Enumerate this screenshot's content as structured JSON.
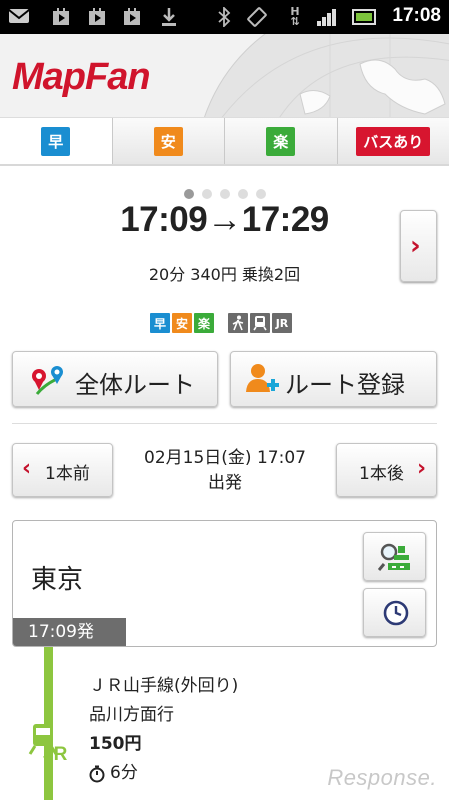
{
  "status_bar": {
    "time": "17:08",
    "icons": [
      "mail-icon",
      "play-store-icon",
      "play-store-icon",
      "play-store-icon",
      "download-icon",
      "bluetooth-icon",
      "screen-rotation-icon",
      "hsdpa-icon",
      "signal-icon",
      "battery-icon"
    ]
  },
  "header": {
    "logo": "MapFan"
  },
  "tabs": [
    {
      "label": "早",
      "color": "#1a8ed1",
      "active": true
    },
    {
      "label": "安",
      "color": "#f08a1c",
      "active": false
    },
    {
      "label": "楽",
      "color": "#3bab3a",
      "active": false
    },
    {
      "label": "バスあり",
      "color": "#d7152f",
      "active": false
    }
  ],
  "route": {
    "time_range": "17:09→17:29",
    "summary": "20分 340円 乗換2回",
    "badges": [
      {
        "label": "早",
        "color": "#1a8ed1"
      },
      {
        "label": "安",
        "color": "#f08a1c"
      },
      {
        "label": "楽",
        "color": "#3bab3a"
      }
    ],
    "modes": [
      {
        "icon": "walk-icon",
        "label": ""
      },
      {
        "icon": "train-icon",
        "label": ""
      },
      {
        "icon": "jr-icon",
        "label": "JR"
      }
    ]
  },
  "actions": {
    "full_route": "全体ルート",
    "register_route": "ルート登録"
  },
  "departure": {
    "prev": "1本前",
    "next": "1本後",
    "date_time": "02月15日(金) 17:07",
    "mode": "出発"
  },
  "station": {
    "name": "東京",
    "depart_tag": "17:09発"
  },
  "segment": {
    "line": "ＪＲ山手線(外回り)",
    "direction": "品川方面行",
    "fare": "150円",
    "duration": "6分",
    "line_color": "#8dc63f",
    "rail_label": "JR"
  },
  "watermark": "Response."
}
